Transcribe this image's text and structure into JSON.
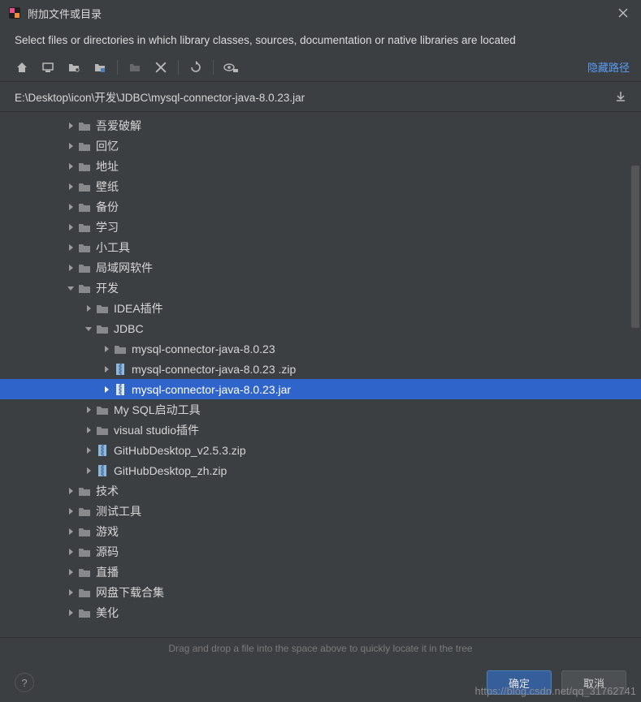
{
  "window": {
    "title": "附加文件或目录",
    "subtitle": "Select files or directories in which library classes, sources, documentation or native libraries are located"
  },
  "toolbar": {
    "hide_path_label": "隐藏路径"
  },
  "path": "E:\\Desktop\\icon\\开发\\JDBC\\mysql-connector-java-8.0.23.jar",
  "tree": [
    {
      "indent": 3,
      "expanded": false,
      "type": "folder",
      "label": "吾爱破解"
    },
    {
      "indent": 3,
      "expanded": false,
      "type": "folder",
      "label": "回忆"
    },
    {
      "indent": 3,
      "expanded": false,
      "type": "folder",
      "label": "地址"
    },
    {
      "indent": 3,
      "expanded": false,
      "type": "folder",
      "label": "壁纸"
    },
    {
      "indent": 3,
      "expanded": false,
      "type": "folder",
      "label": "备份"
    },
    {
      "indent": 3,
      "expanded": false,
      "type": "folder",
      "label": "学习"
    },
    {
      "indent": 3,
      "expanded": false,
      "type": "folder",
      "label": "小工具"
    },
    {
      "indent": 3,
      "expanded": false,
      "type": "folder",
      "label": "局域网软件"
    },
    {
      "indent": 3,
      "expanded": true,
      "type": "folder",
      "label": "开发"
    },
    {
      "indent": 4,
      "expanded": false,
      "type": "folder",
      "label": "IDEA插件"
    },
    {
      "indent": 4,
      "expanded": true,
      "type": "folder",
      "label": "JDBC"
    },
    {
      "indent": 5,
      "expanded": false,
      "type": "folder",
      "label": "mysql-connector-java-8.0.23"
    },
    {
      "indent": 5,
      "expanded": false,
      "type": "archive",
      "label": "mysql-connector-java-8.0.23 .zip"
    },
    {
      "indent": 5,
      "expanded": false,
      "type": "archive",
      "label": "mysql-connector-java-8.0.23.jar",
      "selected": true
    },
    {
      "indent": 4,
      "expanded": false,
      "type": "folder",
      "label": "My SQL启动工具"
    },
    {
      "indent": 4,
      "expanded": false,
      "type": "folder",
      "label": "visual studio插件"
    },
    {
      "indent": 4,
      "expanded": false,
      "type": "archive",
      "label": "GitHubDesktop_v2.5.3.zip"
    },
    {
      "indent": 4,
      "expanded": false,
      "type": "archive",
      "label": "GitHubDesktop_zh.zip"
    },
    {
      "indent": 3,
      "expanded": false,
      "type": "folder",
      "label": "技术"
    },
    {
      "indent": 3,
      "expanded": false,
      "type": "folder",
      "label": "测试工具"
    },
    {
      "indent": 3,
      "expanded": false,
      "type": "folder",
      "label": "游戏"
    },
    {
      "indent": 3,
      "expanded": false,
      "type": "folder",
      "label": "源码"
    },
    {
      "indent": 3,
      "expanded": false,
      "type": "folder",
      "label": "直播"
    },
    {
      "indent": 3,
      "expanded": false,
      "type": "folder",
      "label": "网盘下载合集"
    },
    {
      "indent": 3,
      "expanded": false,
      "type": "folder",
      "label": "美化"
    }
  ],
  "hint": "Drag and drop a file into the space above to quickly locate it in the tree",
  "buttons": {
    "ok": "确定",
    "cancel": "取消"
  },
  "watermark": "https://blog.csdn.net/qq_31762741"
}
